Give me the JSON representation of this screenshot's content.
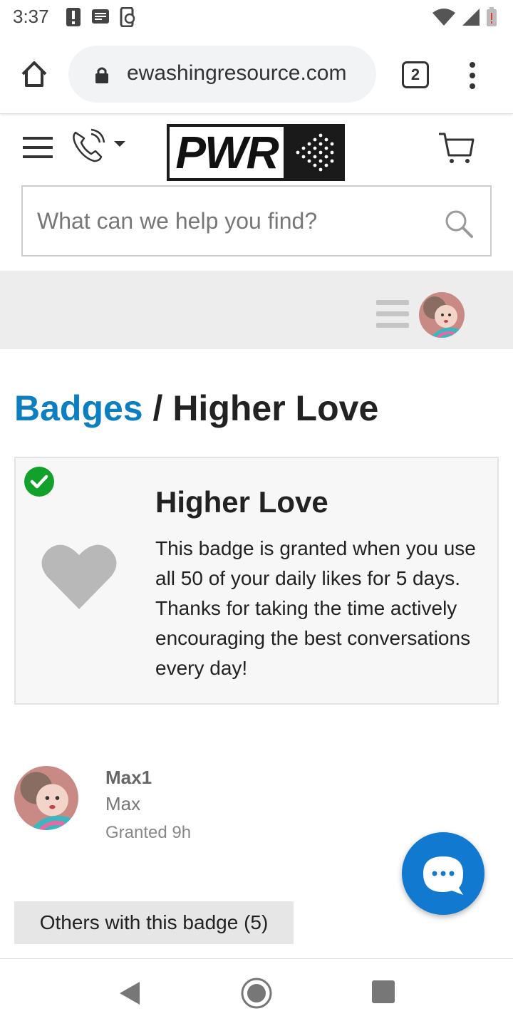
{
  "status_bar": {
    "time": "3:37"
  },
  "browser": {
    "url": "ewashingresource.com",
    "tab_count": "2"
  },
  "site": {
    "logo_text": "PWR"
  },
  "search": {
    "placeholder": "What can we help you find?"
  },
  "breadcrumb": {
    "parent": "Badges",
    "separator": " / ",
    "current": "Higher Love"
  },
  "badge": {
    "title": "Higher Love",
    "description": "This badge is granted when you use all 50 of your daily likes for 5 days. Thanks for taking the time actively encouraging the best conversations every day!",
    "icon": "heart-icon",
    "granted": true
  },
  "granted_user": {
    "username": "Max1",
    "name": "Max",
    "granted_text": "Granted 9h"
  },
  "others_button": {
    "label": "Others with this badge (5)"
  },
  "colors": {
    "link": "#0c7fc2",
    "check": "#12a12a",
    "fab": "#1279d0"
  }
}
